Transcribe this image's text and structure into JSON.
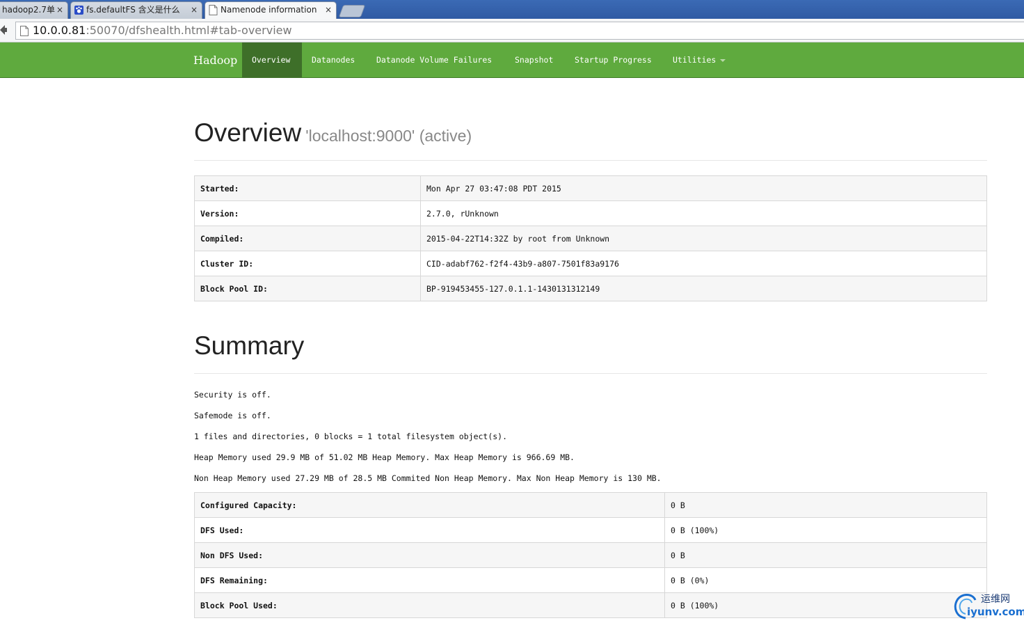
{
  "browser": {
    "tabs": [
      {
        "title": "hadoop2.7单",
        "active": false
      },
      {
        "title": "fs.defaultFS 含义是什么",
        "active": false
      },
      {
        "title": "Namenode information",
        "active": true
      }
    ],
    "close_glyph": "×",
    "url_host": "10.0.0.81",
    "url_rest": ":50070/dfshealth.html#tab-overview"
  },
  "navbar": {
    "brand": "Hadoop",
    "items": [
      "Overview",
      "Datanodes",
      "Datanode Volume Failures",
      "Snapshot",
      "Startup Progress",
      "Utilities"
    ],
    "active_index": 0,
    "color": "#5faa3e",
    "active_color": "#3e6f29"
  },
  "overview": {
    "title": "Overview",
    "subtitle": "'localhost:9000' (active)",
    "rows": [
      {
        "key": "Started:",
        "value": "Mon Apr 27 03:47:08 PDT 2015"
      },
      {
        "key": "Version:",
        "value": "2.7.0, rUnknown"
      },
      {
        "key": "Compiled:",
        "value": "2015-04-22T14:32Z by root from Unknown"
      },
      {
        "key": "Cluster ID:",
        "value": "CID-adabf762-f2f4-43b9-a807-7501f83a9176"
      },
      {
        "key": "Block Pool ID:",
        "value": "BP-919453455-127.0.1.1-1430131312149"
      }
    ]
  },
  "summary": {
    "title": "Summary",
    "lines": [
      "Security is off.",
      "Safemode is off.",
      "1 files and directories, 0 blocks = 1 total filesystem object(s).",
      "Heap Memory used 29.9 MB of 51.02 MB Heap Memory. Max Heap Memory is 966.69 MB.",
      "Non Heap Memory used 27.29 MB of 28.5 MB Commited Non Heap Memory. Max Non Heap Memory is 130 MB."
    ],
    "rows": [
      {
        "key": "Configured Capacity:",
        "value": "0 B"
      },
      {
        "key": "DFS Used:",
        "value": "0 B (100%)"
      },
      {
        "key": "Non DFS Used:",
        "value": "0 B"
      },
      {
        "key": "DFS Remaining:",
        "value": "0 B (0%)"
      },
      {
        "key": "Block Pool Used:",
        "value": "0 B (100%)"
      }
    ]
  },
  "watermark": {
    "line1": "运维网",
    "line2": "iyunv.com"
  }
}
